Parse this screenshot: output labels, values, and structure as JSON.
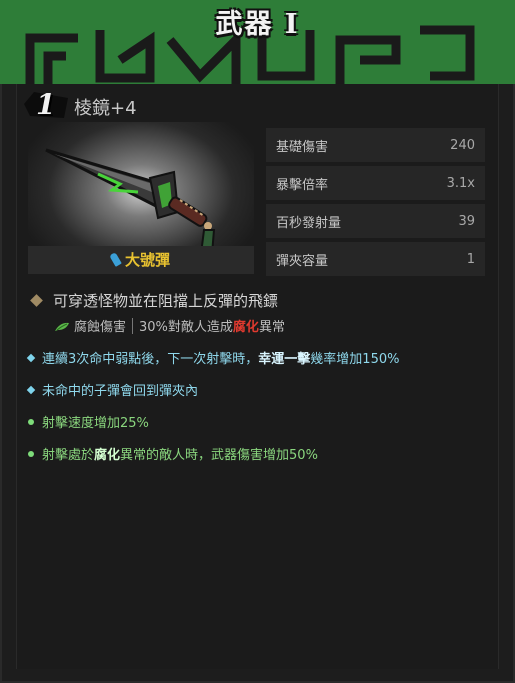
{
  "header": {
    "title": "武器 I"
  },
  "weapon": {
    "level": "1",
    "name": "棱鏡+4",
    "ammo_type": "大號彈"
  },
  "stats": [
    {
      "label": "基礎傷害",
      "value": "240"
    },
    {
      "label": "暴擊倍率",
      "value": "3.1x"
    },
    {
      "label": "百秒發射量",
      "value": "39"
    },
    {
      "label": "彈夾容量",
      "value": "1"
    }
  ],
  "description": {
    "main": "可穿透怪物並在阻擋上反彈的飛鏢",
    "sub_label": "腐蝕傷害",
    "sub_prefix": "30%對敵人造成",
    "sub_highlight": "腐化",
    "sub_suffix": "異常"
  },
  "traits": [
    {
      "kind": "blue",
      "pre": "連續3次命中弱點後，下一次射擊時，",
      "hl": "幸運一擊",
      "post": "幾率增加150%"
    },
    {
      "kind": "blue",
      "pre": "未命中的子彈會回到彈夾內",
      "hl": "",
      "post": ""
    },
    {
      "kind": "green",
      "pre": "射擊速度增加25%",
      "hl": "",
      "post": ""
    },
    {
      "kind": "green",
      "pre": "射擊處於",
      "hl": "腐化",
      "post": "異常的敵人時，武器傷害增加50%"
    }
  ],
  "colors": {
    "banner": "#2e7d38",
    "ammo_text": "#e8c230",
    "corrosion_red": "#e03a2f",
    "blue_trait": "#8fd8ec",
    "green_trait": "#8ad67e"
  },
  "icons": {
    "ammo": "bullet-icon",
    "corrosion": "corrosion-leaf-icon",
    "level": "level-badge-icon"
  }
}
